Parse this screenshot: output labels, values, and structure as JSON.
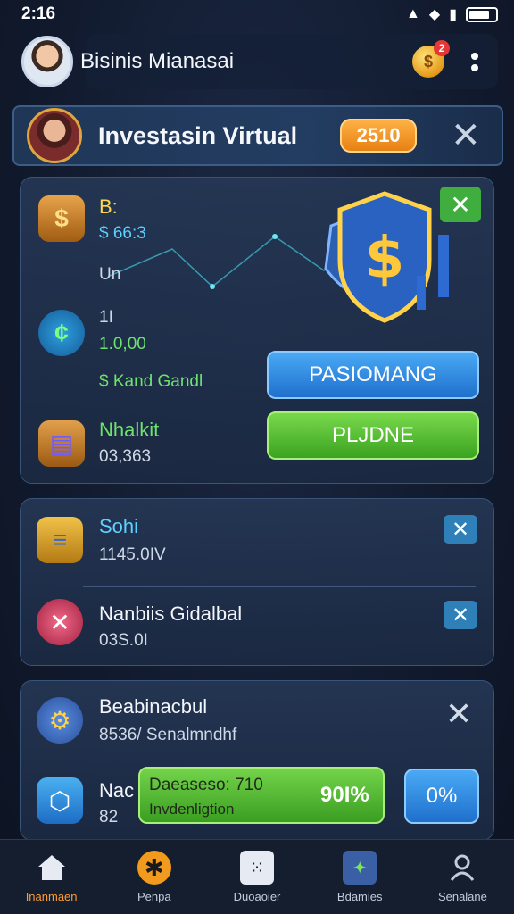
{
  "status_bar": {
    "time": "2:16"
  },
  "header": {
    "title": "Bisinis Mianasai",
    "coin_badge": "2",
    "coin_symbol": "$"
  },
  "banner": {
    "title": "Investasin Virtual",
    "score": "2510"
  },
  "main_card": {
    "rows": [
      {
        "title": "B:",
        "value": "$ 66:3"
      },
      {
        "title": "Un",
        "value": ""
      },
      {
        "title": "1I",
        "value": "1.0,00"
      },
      {
        "title": "$ Kand Gandl",
        "value": ""
      },
      {
        "title": "Nhalkit",
        "value": "03,363"
      }
    ],
    "button_primary": "PASIOMANG",
    "button_secondary": "PLJDNE"
  },
  "mid_card": {
    "rows": [
      {
        "title": "Sohi",
        "value": "1145.0IV"
      },
      {
        "title": "Nanbiis Gidalbal",
        "value": "03S.0I"
      }
    ]
  },
  "bottom_card": {
    "rows": [
      {
        "title": "Beabinacbul",
        "value": "8536/ Senalmndhf"
      },
      {
        "title": "Nac",
        "value": "82"
      }
    ],
    "progress": {
      "line1": "Daeaseso: 710",
      "line2": "Invdenligtion",
      "value": "90I%"
    },
    "percent_button": "0%"
  },
  "nav": [
    {
      "label": "Inanmaen",
      "icon": "home-icon",
      "active": true
    },
    {
      "label": "Penpa",
      "icon": "star-icon",
      "active": false
    },
    {
      "label": "Duoaoier",
      "icon": "dice-icon",
      "active": false
    },
    {
      "label": "Bdamies",
      "icon": "puzzle-icon",
      "active": false
    },
    {
      "label": "Senalane",
      "icon": "user-icon",
      "active": false
    }
  ],
  "colors": {
    "accent_orange": "#e67e10",
    "accent_green": "#3ba320",
    "accent_blue": "#1f70cc",
    "background": "#121b2f"
  }
}
